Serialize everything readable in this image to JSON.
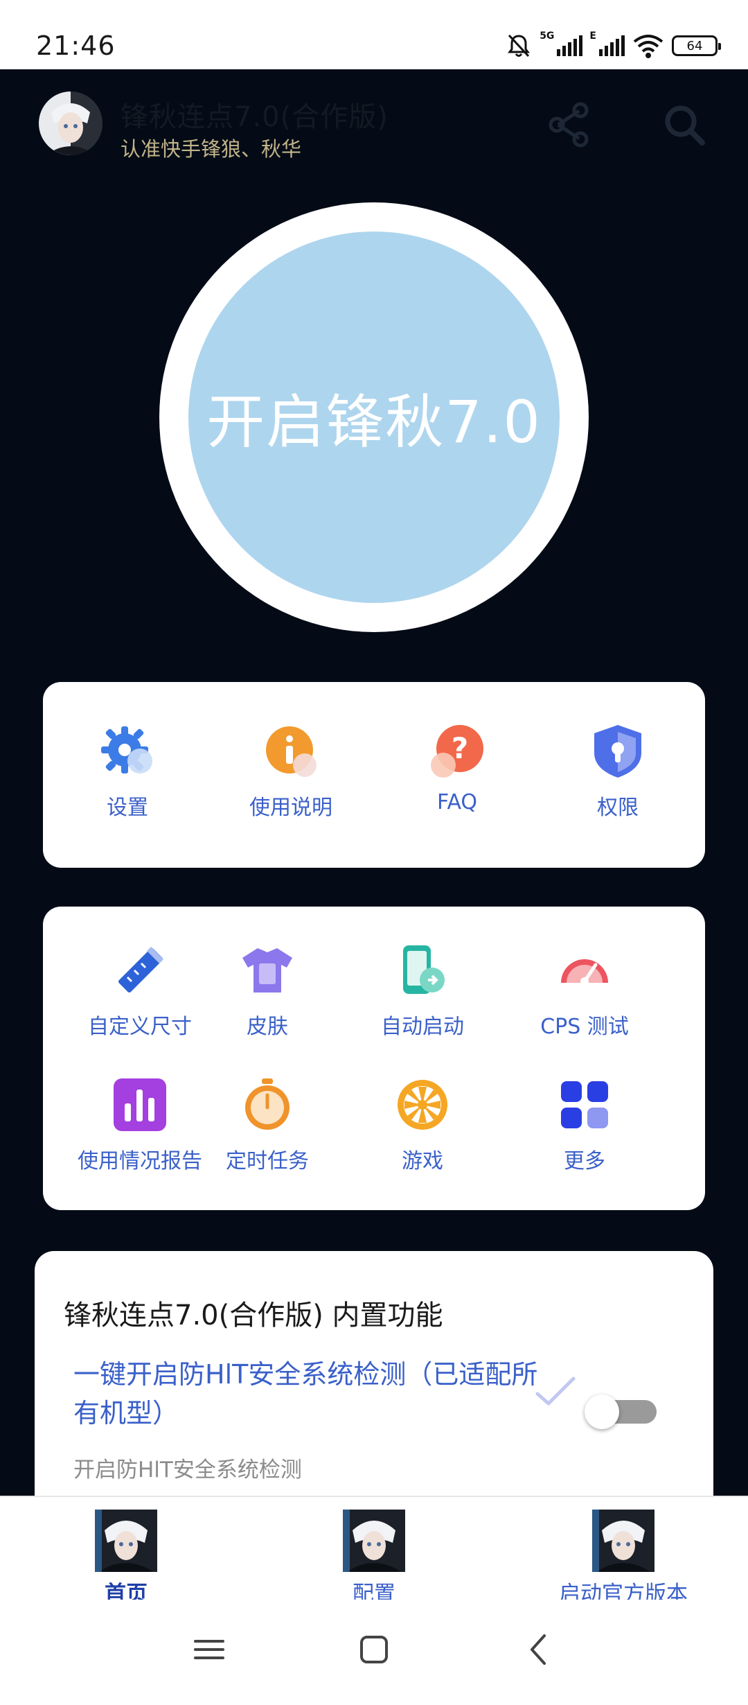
{
  "status_bar": {
    "time": "21:46",
    "network_5g": "5G",
    "network_e": "E",
    "battery": "64"
  },
  "header": {
    "title": "锋秋连点7.0(合作版)",
    "subtitle": "认准快手锋狼、秋华",
    "share_icon": "share-icon",
    "search_icon": "search-icon"
  },
  "start_button": {
    "label": "开启锋秋7.0",
    "fill_color": "#aed5ee"
  },
  "quick_menu": [
    {
      "label": "设置",
      "icon": "gear-icon"
    },
    {
      "label": "使用说明",
      "icon": "info-icon"
    },
    {
      "label": "FAQ",
      "icon": "question-icon"
    },
    {
      "label": "权限",
      "icon": "shield-icon"
    }
  ],
  "tools": [
    {
      "label": "自定义尺寸",
      "icon": "ruler-pencil-icon"
    },
    {
      "label": "皮肤",
      "icon": "tshirt-icon"
    },
    {
      "label": "自动启动",
      "icon": "phone-link-icon"
    },
    {
      "label": "CPS 测试",
      "icon": "speedometer-icon"
    },
    {
      "label": "使用情况报告",
      "icon": "bar-chart-icon"
    },
    {
      "label": "定时任务",
      "icon": "stopwatch-icon"
    },
    {
      "label": "游戏",
      "icon": "wheel-icon"
    },
    {
      "label": "更多",
      "icon": "grid-icon"
    }
  ],
  "features": {
    "title": "锋秋连点7.0(合作版) 内置功能",
    "item": {
      "name": "一键开启防HlT安全系统检测（已适配所有机型）",
      "description": "开启防HlT安全系统检测",
      "enabled": false
    }
  },
  "bottom_nav": [
    {
      "label": "首页",
      "active": true
    },
    {
      "label": "配置",
      "active": false
    },
    {
      "label": "启动官方版本",
      "active": false
    }
  ],
  "colors": {
    "background": "#040b16",
    "accent_blue": "#3a60c9",
    "subtitle_gold": "#c2b48a"
  }
}
